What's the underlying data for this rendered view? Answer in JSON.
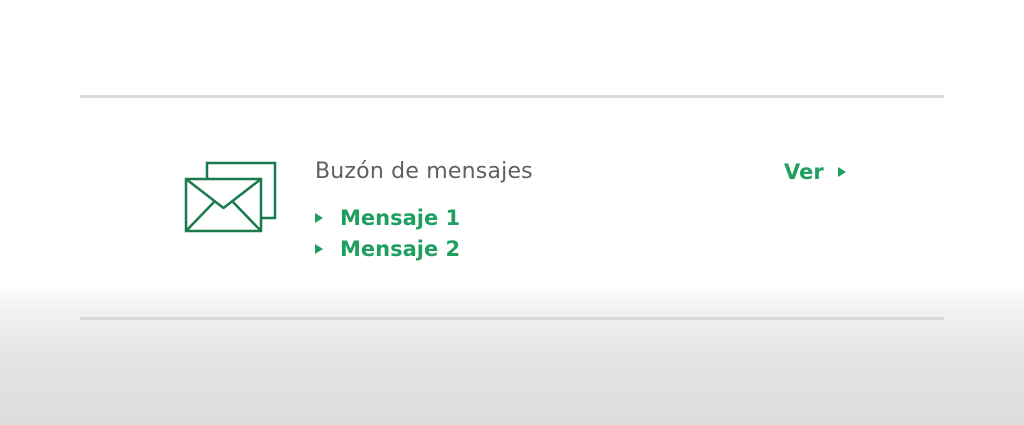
{
  "mailbox": {
    "title": "Buzón de mensajes",
    "messages": [
      {
        "label": "Mensaje 1"
      },
      {
        "label": "Mensaje 2"
      }
    ],
    "view_label": "Ver",
    "icon": "envelopes-icon"
  },
  "colors": {
    "accent": "#1f9f5f",
    "icon_stroke": "#1a7a4c",
    "title_text": "#606060",
    "divider": "#dadada"
  }
}
